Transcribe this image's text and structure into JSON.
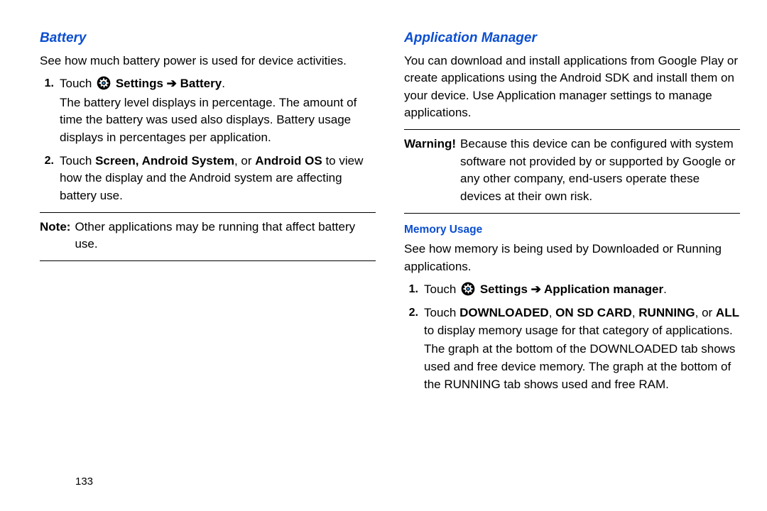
{
  "page_number": "133",
  "left": {
    "heading": "Battery",
    "intro": "See how much battery power is used for device activities.",
    "step1": {
      "num": "1.",
      "touch": "Touch",
      "path": "Settings ➔ Battery",
      "period": ".",
      "desc": "The battery level displays in percentage. The amount of time the battery was used also displays. Battery usage displays in percentages per application."
    },
    "step2": {
      "num": "2.",
      "pre": "Touch ",
      "bold": "Screen, Android System",
      "mid": ", or ",
      "bold2": "Android OS",
      "post": " to view how the display and the Android system are affecting battery use."
    },
    "note_label": "Note:",
    "note_text": "Other applications may be running that affect battery use."
  },
  "right": {
    "heading": "Application Manager",
    "intro": "You can download and install applications from Google Play or create applications using the Android SDK and install them on your device. Use Application manager settings to manage applications.",
    "warning_label": "Warning!",
    "warning_text": "Because this device can be configured with system software not provided by or supported by Google or any other company, end-users operate these devices at their own risk.",
    "memory_heading": "Memory Usage",
    "memory_intro": "See how memory is being used by Downloaded or Running applications.",
    "m_step1": {
      "num": "1.",
      "touch": "Touch",
      "path": "Settings ➔ Application manager",
      "period": "."
    },
    "m_step2": {
      "num": "2.",
      "pre": "Touch ",
      "b1": "DOWNLOADED",
      "c1": ", ",
      "b2": "ON SD CARD",
      "c2": ", ",
      "b3": "RUNNING",
      "c3": ", or ",
      "b4": "ALL",
      "post": " to display memory usage for that category of applications.",
      "extra": "The graph at the bottom of the DOWNLOADED tab shows used and free device memory. The graph at the bottom of the RUNNING tab shows used and free RAM."
    }
  }
}
